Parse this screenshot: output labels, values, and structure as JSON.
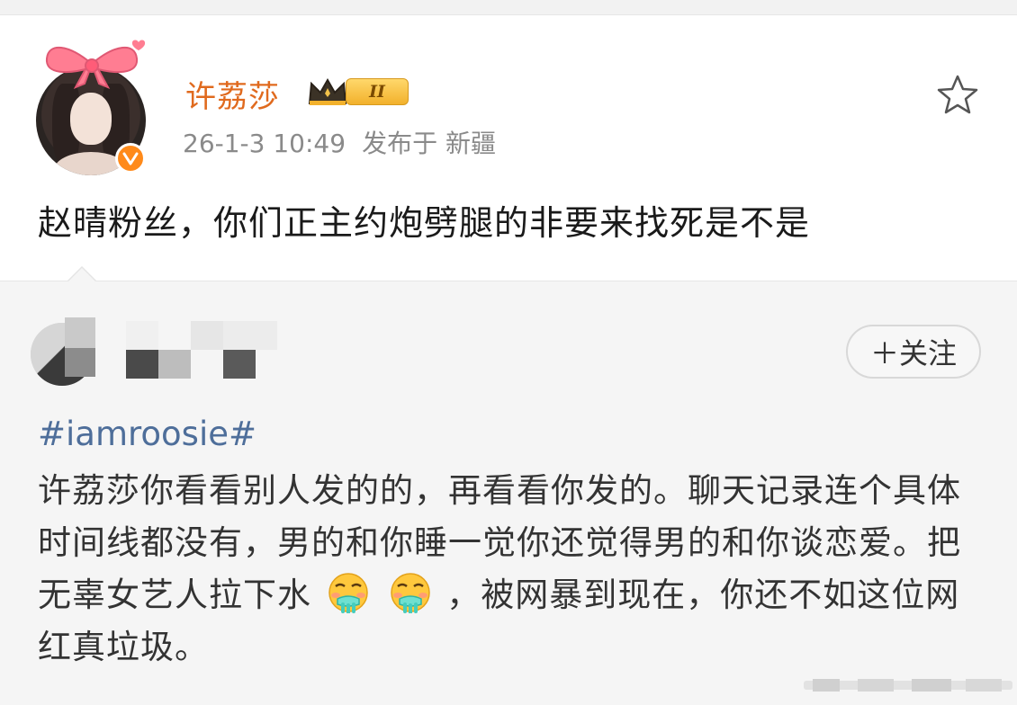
{
  "post": {
    "username": "许荔莎",
    "user_level": "II",
    "timestamp": "26-1-3 10:49",
    "location": "发布于 新疆",
    "text": "赵晴粉丝，你们正主约炮劈腿的非要来找死是不是",
    "icons": {
      "avatar": "avatar-photo",
      "bow": "pink-bow-icon",
      "verify": "verified-v-icon",
      "crown": "crown-icon",
      "star": "star-outline-icon"
    }
  },
  "repost": {
    "follow_button": "＋关注",
    "hashtag": "#iamroosie#",
    "text_part1": "许荔莎你看看别人发的的，再看看你发的。聊天记录连个具体时间线都没有，男的和你睡一觉你还觉得男的和你谈恋爱。把无辜女艺人拉下水",
    "text_part2": "，被网暴到现在，你还不如这位网红真垃圾。",
    "emoji_names": [
      "gross-face-emoji",
      "gross-face-emoji"
    ]
  },
  "colors": {
    "username": "#e06a1e",
    "hashtag": "#4e6e9a",
    "verify_badge": "#ff8a1a",
    "repost_bg": "#f5f5f5"
  }
}
